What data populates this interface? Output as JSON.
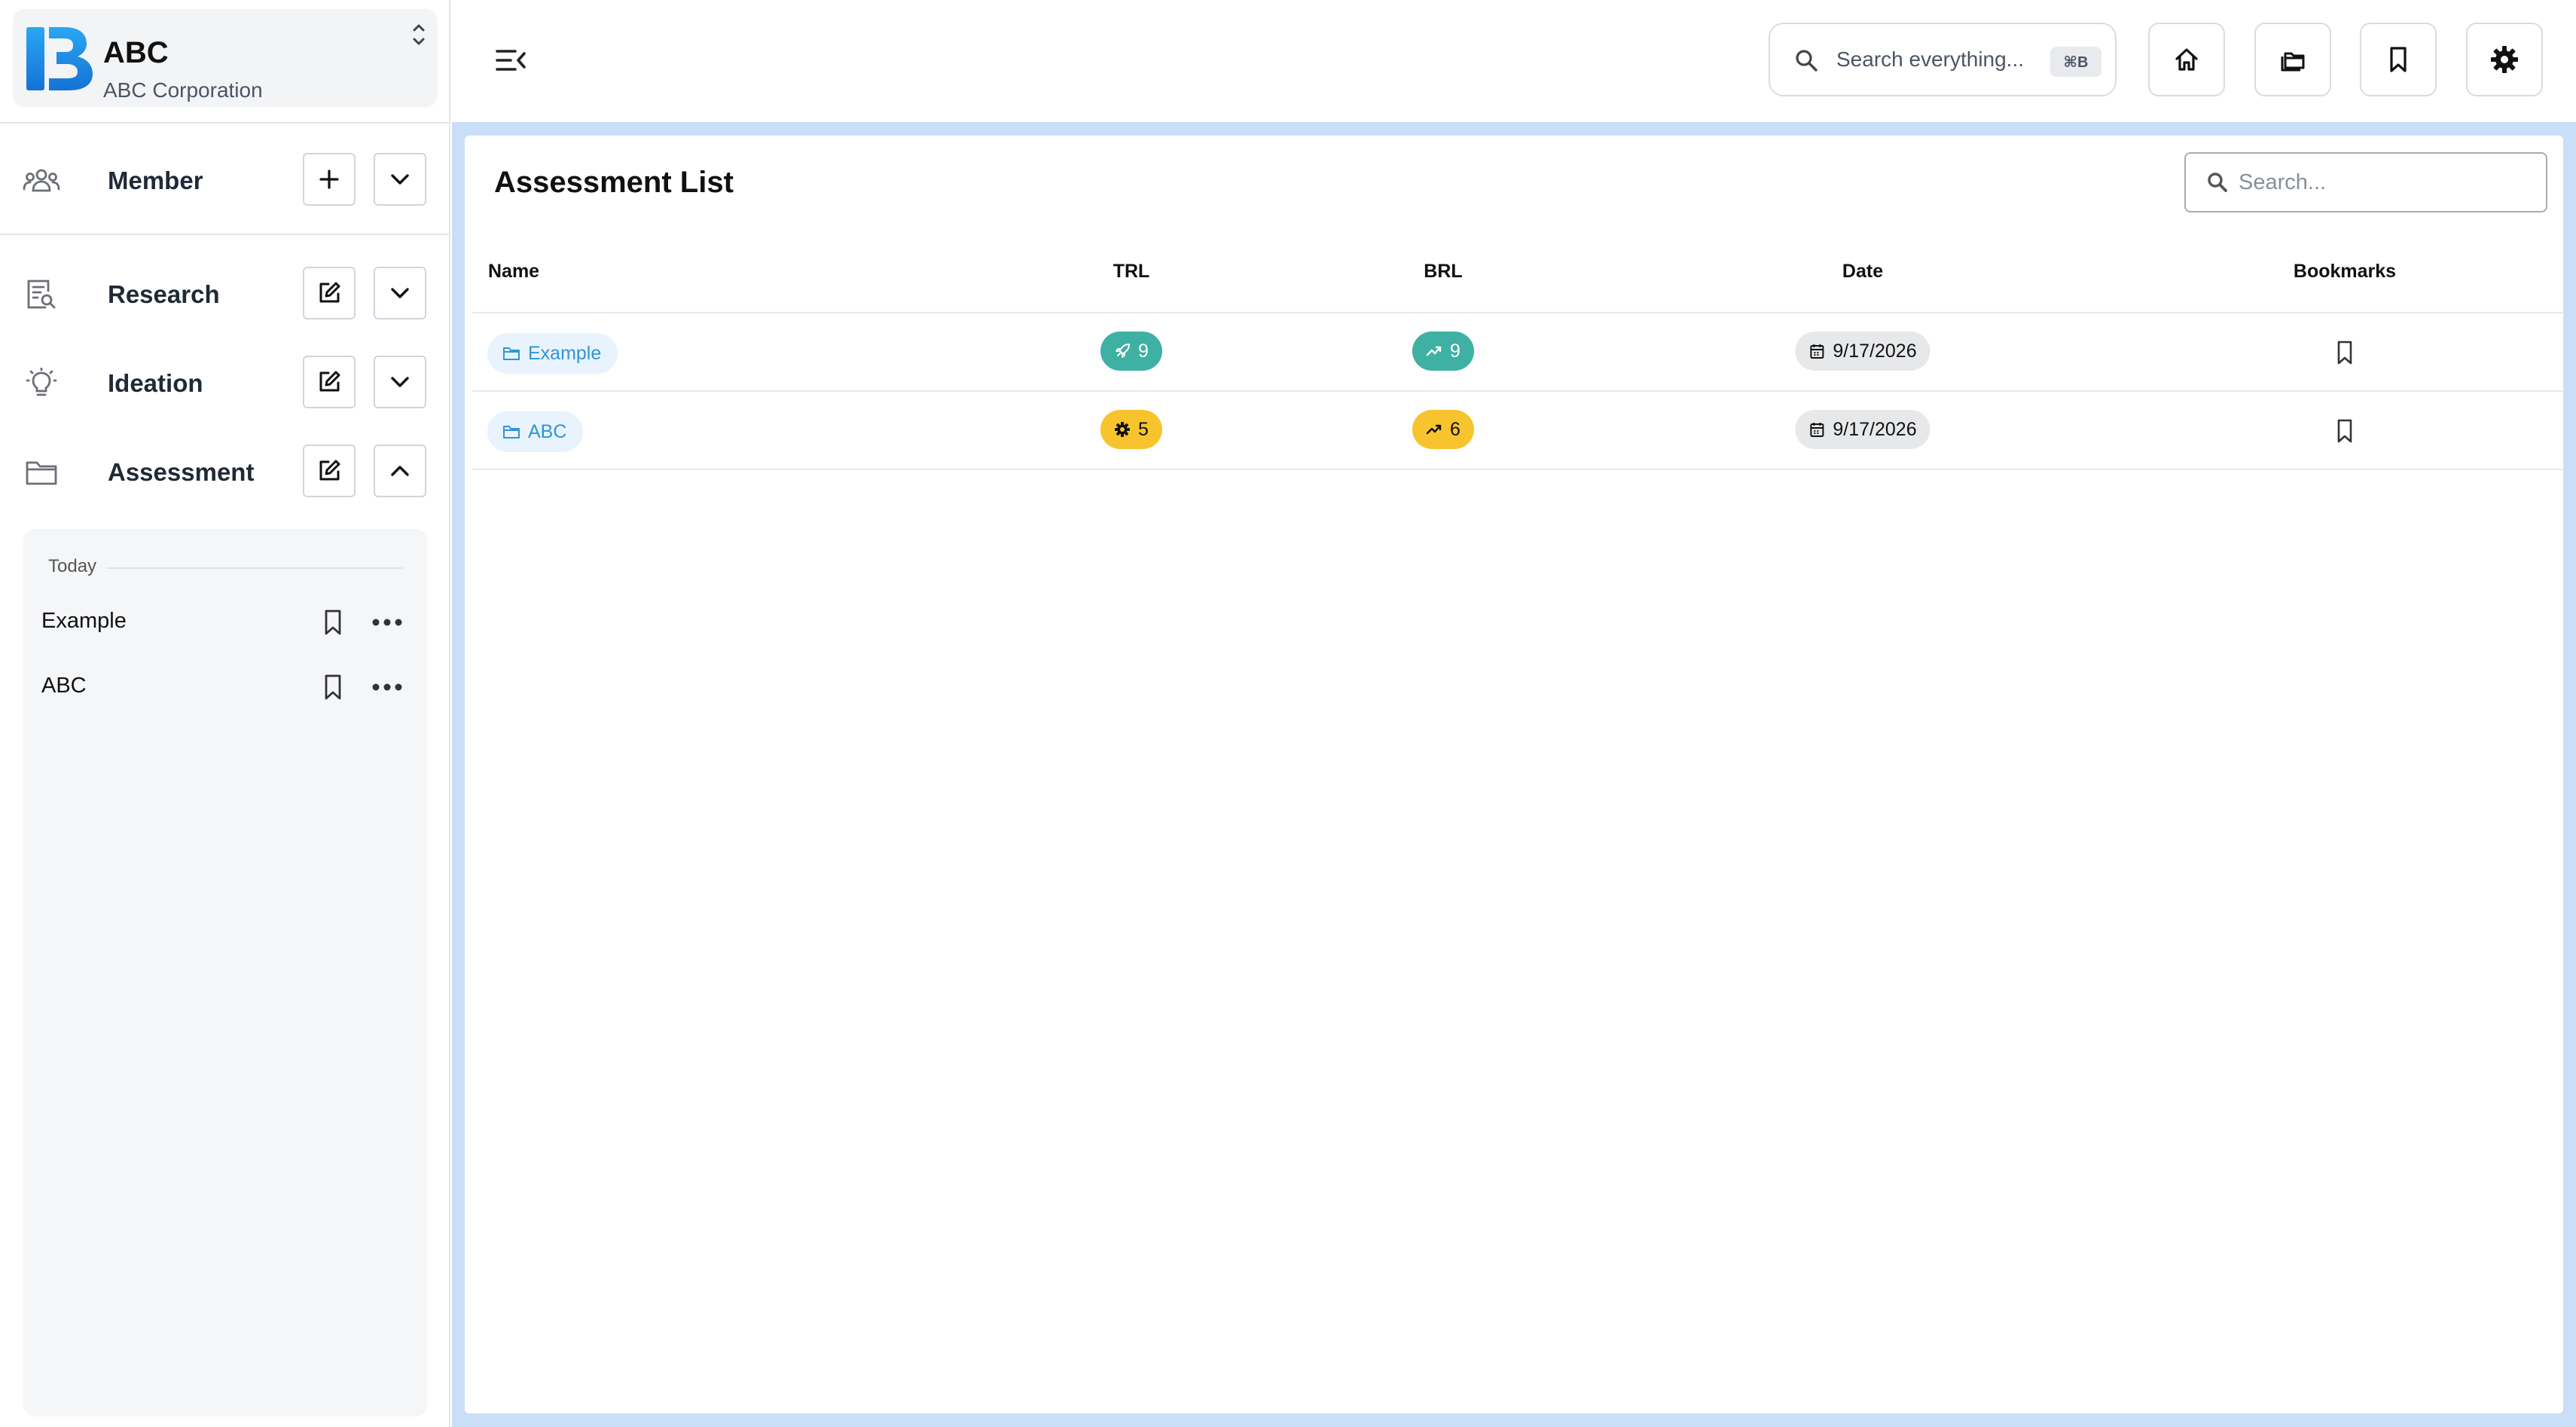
{
  "org": {
    "name": "ABC",
    "subtitle": "ABC Corporation"
  },
  "sidebar": {
    "nav": [
      {
        "label": "Member",
        "action1": "add",
        "expanded": false
      },
      {
        "label": "Research",
        "action1": "edit",
        "expanded": false
      },
      {
        "label": "Ideation",
        "action1": "edit",
        "expanded": false
      },
      {
        "label": "Assessment",
        "action1": "edit",
        "expanded": true
      }
    ],
    "history": {
      "group": "Today",
      "items": [
        {
          "label": "Example"
        },
        {
          "label": "ABC"
        }
      ]
    }
  },
  "topbar": {
    "search_placeholder": "Search everything...",
    "shortcut": "⌘B",
    "buttons": [
      "home-icon",
      "folders-icon",
      "bookmark-icon",
      "gear-icon"
    ]
  },
  "main": {
    "title": "Assessment List",
    "search_placeholder": "Search...",
    "columns": {
      "name": "Name",
      "trl": "TRL",
      "brl": "BRL",
      "date": "Date",
      "bookmarks": "Bookmarks"
    },
    "rows": [
      {
        "name": "Example",
        "trl": "9",
        "trl_color": "#3fb0a4",
        "brl": "9",
        "brl_color": "#3fb0a4",
        "date": "9/17/2026",
        "bookmarked": false
      },
      {
        "name": "ABC",
        "trl": "5",
        "trl_color": "#f8c42e",
        "brl": "6",
        "brl_color": "#f8c42e",
        "date": "9/17/2026",
        "bookmarked": false
      }
    ]
  },
  "colors": {
    "accent": "#1a8fe3",
    "main_bg": "#c8dff7",
    "teal": "#3fb0a4",
    "yellow": "#f8c42e"
  }
}
